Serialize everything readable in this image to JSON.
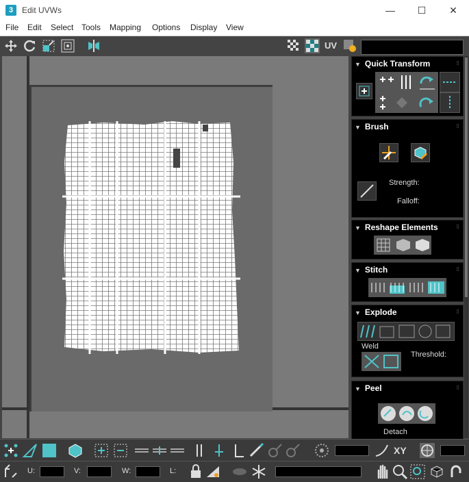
{
  "window": {
    "title": "Edit UVWs",
    "app_icon": "3",
    "minimize": "—",
    "maximize": "☐",
    "close": "✕"
  },
  "menu": [
    "File",
    "Edit",
    "Select",
    "Tools",
    "Mapping",
    "Options",
    "Display",
    "View"
  ],
  "toolbar": {
    "uv_label": "UV"
  },
  "panel": {
    "quick_transform": {
      "title": "Quick Transform"
    },
    "brush": {
      "title": "Brush",
      "strength_label": "Strength:",
      "falloff_label": "Falloff:"
    },
    "reshape": {
      "title": "Reshape Elements"
    },
    "stitch": {
      "title": "Stitch"
    },
    "explode": {
      "title": "Explode",
      "weld_label": "Weld",
      "threshold_label": "Threshold:"
    },
    "peel": {
      "title": "Peel",
      "detach_label": "Detach"
    }
  },
  "bottom": {
    "xy_label": "XY",
    "u_label": "U:",
    "v_label": "V:",
    "w_label": "W:",
    "l_label": "L:"
  },
  "colors": {
    "accent": "#4fc3c8",
    "panel_bg": "#000000",
    "viewport": "#7a7a7a"
  }
}
